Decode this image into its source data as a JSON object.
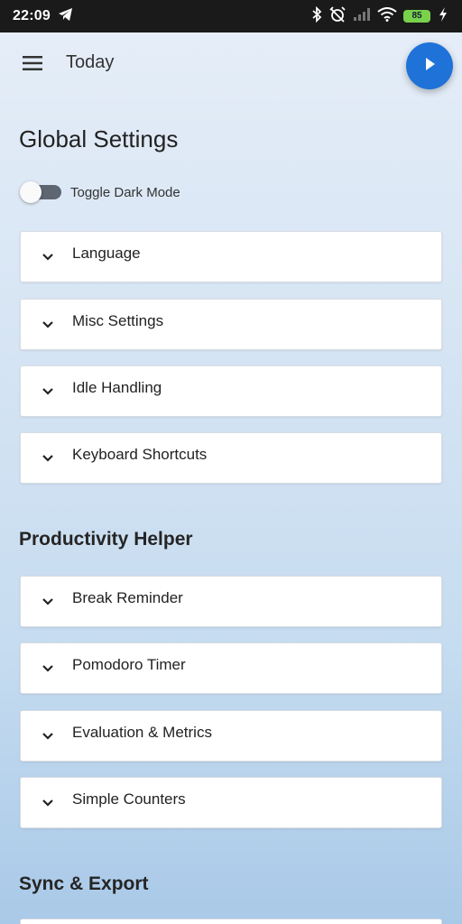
{
  "status_bar": {
    "time": "22:09",
    "battery": "85",
    "icons": [
      "telegram-icon",
      "bluetooth-icon",
      "alarm-off-icon",
      "signal-icon",
      "wifi-icon",
      "battery-icon",
      "charging-icon"
    ]
  },
  "app_bar": {
    "title": "Today",
    "menu_icon": "hamburger-menu-icon",
    "play_icon": "play-icon"
  },
  "global_settings": {
    "title": "Global Settings",
    "toggle_label": "Toggle Dark Mode",
    "toggle_on": false,
    "panels": [
      {
        "label": "Language"
      },
      {
        "label": "Misc Settings"
      },
      {
        "label": "Idle Handling"
      },
      {
        "label": "Keyboard Shortcuts"
      }
    ]
  },
  "productivity_helper": {
    "title": "Productivity Helper",
    "panels": [
      {
        "label": "Break Reminder"
      },
      {
        "label": "Pomodoro Timer"
      },
      {
        "label": "Evaluation & Metrics"
      },
      {
        "label": "Simple Counters"
      }
    ]
  },
  "sync_export": {
    "title": "Sync & Export"
  },
  "colors": {
    "accent": "#1e72d8",
    "status_bar": "#1a1a1a",
    "battery": "#7ad14b"
  }
}
